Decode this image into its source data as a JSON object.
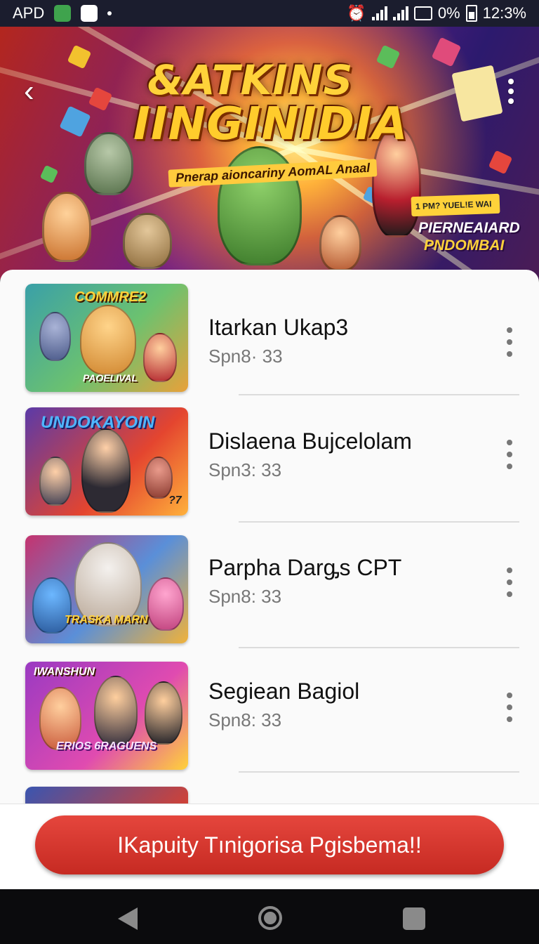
{
  "status_bar": {
    "carrier": "APD",
    "battery": "0%",
    "time": "12:3%"
  },
  "hero": {
    "title_line1": "&ATKINS",
    "title_line2": "IINGINIDIA",
    "subtitle": "Pnerap aioncariny AomAL Anaal",
    "promo_badge": "1  PM? YUEL!E WAI",
    "promo_line1": "PIERNEAIARD",
    "promo_line2": "PNDOMBAI"
  },
  "list": {
    "items": [
      {
        "title": "Itarkan Ukap3",
        "subtitle": "Spn8· 33",
        "thumb_top": "COMMRE2",
        "thumb_bottom": "PAOELIVAL",
        "colors": [
          "#3aa0a8",
          "#6cc26f",
          "#e8a13a"
        ]
      },
      {
        "title": "Dislaena Bujcelolam",
        "subtitle": "Spn3: 33",
        "thumb_top": "UNDOKAYOIN",
        "thumb_bottom": "?7",
        "colors": [
          "#5b3aa8",
          "#e4452f",
          "#ffb13b"
        ]
      },
      {
        "title": "Parpha Darᶃs CPT",
        "subtitle": "Spn8: 33",
        "thumb_top": "",
        "thumb_bottom": "TRASKA MARN",
        "colors": [
          "#c5336f",
          "#5a8fd8",
          "#f0b23a"
        ]
      },
      {
        "title": "Segiean Bagiol",
        "subtitle": "Spn8: 33",
        "thumb_top": "IWANSHUN",
        "thumb_bottom": "ERIOS 6RAGUENS",
        "colors": [
          "#9a3ac2",
          "#e04bb0",
          "#ffd23a"
        ]
      }
    ]
  },
  "cta": {
    "label": "IKapuity Tınigorisa Pgisbema!!"
  }
}
